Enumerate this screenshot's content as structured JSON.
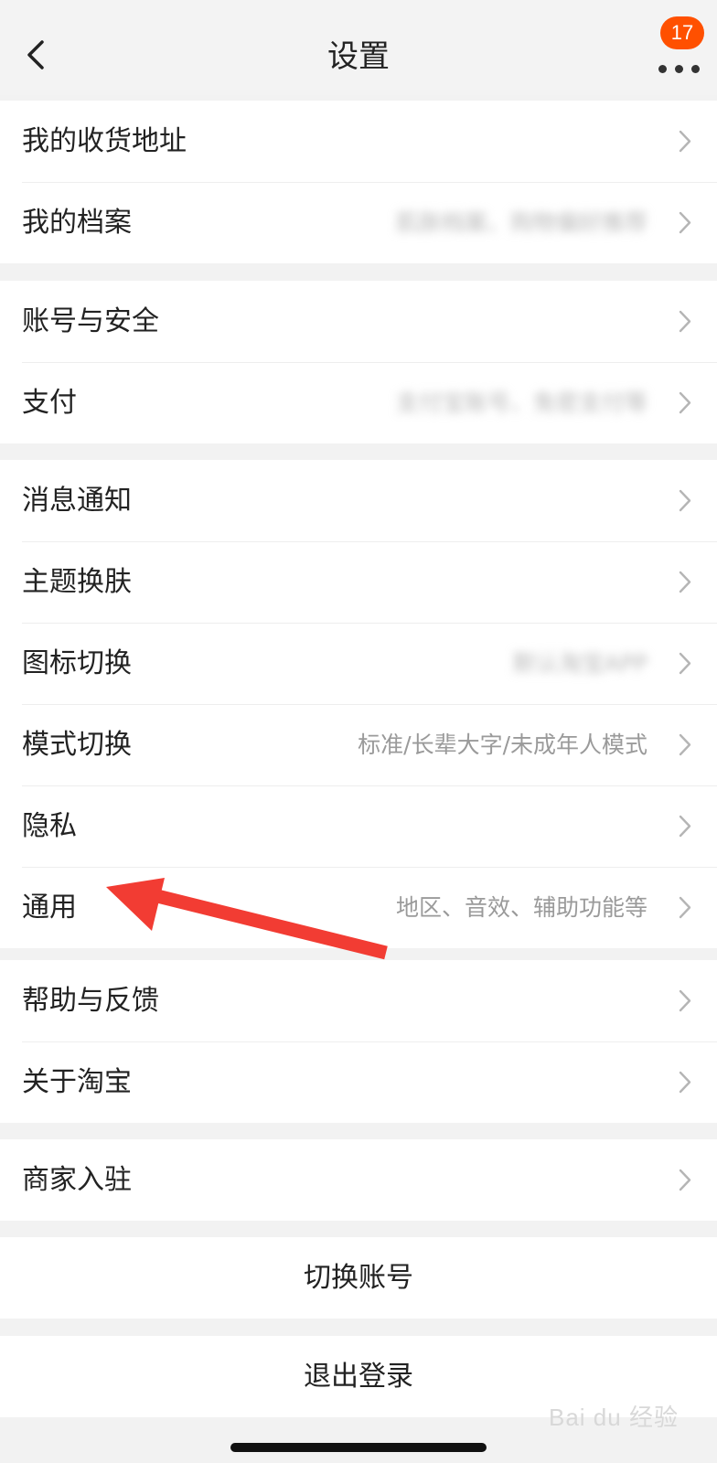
{
  "header": {
    "title": "设置",
    "badge_count": "17"
  },
  "groups": [
    [
      {
        "label": "我的收货地址",
        "value": ""
      },
      {
        "label": "我的档案",
        "value": "肌肤档案、购物偏好推荐",
        "value_blurred": true
      }
    ],
    [
      {
        "label": "账号与安全",
        "value": ""
      },
      {
        "label": "支付",
        "value": "支付宝账号、免密支付等",
        "value_blurred": true
      }
    ],
    [
      {
        "label": "消息通知",
        "value": ""
      },
      {
        "label": "主题换肤",
        "value": ""
      },
      {
        "label": "图标切换",
        "value": "默认淘宝APP",
        "value_blurred": true
      },
      {
        "label": "模式切换",
        "value": "标准/长辈大字/未成年人模式"
      },
      {
        "label": "隐私",
        "value": ""
      },
      {
        "label": "通用",
        "value": "地区、音效、辅助功能等"
      }
    ],
    [
      {
        "label": "帮助与反馈",
        "value": ""
      },
      {
        "label": "关于淘宝",
        "value": ""
      }
    ],
    [
      {
        "label": "商家入驻",
        "value": ""
      }
    ]
  ],
  "actions": {
    "switch_account": "切换账号",
    "logout": "退出登录"
  },
  "icons": {
    "back": "chevron-left-icon",
    "more": "more-dots-icon",
    "row_arrow": "chevron-right-icon"
  },
  "colors": {
    "badge": "#ff5000",
    "annotation_arrow": "#f23c33",
    "background": "#f2f2f2"
  },
  "watermark": "Bai du 经验"
}
